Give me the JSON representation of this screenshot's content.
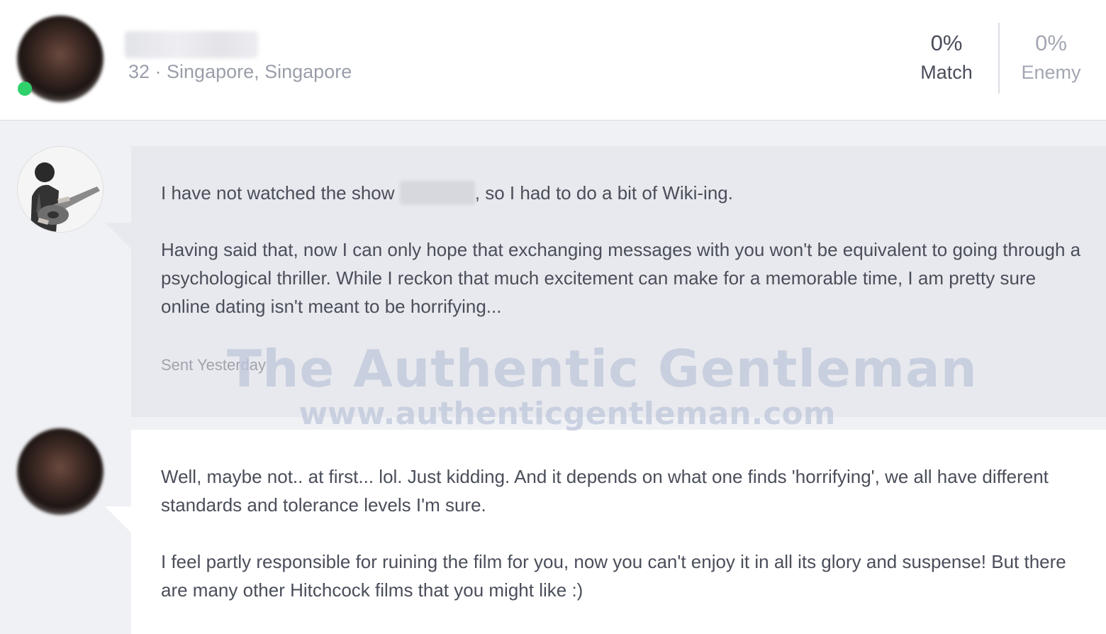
{
  "header": {
    "profile_sub": "32 · Singapore, Singapore",
    "match": {
      "value": "0%",
      "label": "Match"
    },
    "enemy": {
      "value": "0%",
      "label": "Enemy"
    },
    "online_color": "#2fd16b"
  },
  "messages": [
    {
      "p1_before": "I have not watched the show ",
      "p1_after": ", so I had to do a bit of Wiki-ing.",
      "p2": "Having said that, now I can only hope that exchanging messages with you won't be equivalent to going through a psychological thriller. While I reckon that much excitement can make for a memorable time, I am pretty sure online dating isn't meant to be horrifying...",
      "status": "Sent Yesterday"
    },
    {
      "p1": "Well, maybe not.. at first... lol. Just kidding. And it depends on what one finds 'horrifying', we all have different standards and tolerance levels I'm sure.",
      "p2": "I feel partly responsible for ruining the film for you, now you can't enjoy it in all its glory and suspense! But there are many other Hitchcock films that you might like :)"
    }
  ],
  "watermark": {
    "title": "The Authentic Gentleman",
    "url": "www.authenticgentleman.com"
  },
  "icons": {
    "online": "online-status-dot",
    "avatar_sender": "guitar-player-photo",
    "avatar_match": "blurred-profile-photo"
  }
}
